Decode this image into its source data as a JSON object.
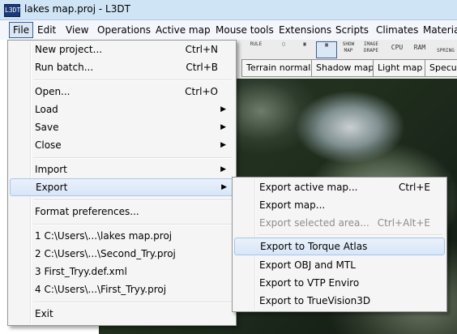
{
  "window": {
    "title": "lakes map.proj - L3DT",
    "icon": "L3DT"
  },
  "menubar": [
    "File",
    "Edit",
    "View",
    "Operations",
    "Active map",
    "Mouse tools",
    "Extensions",
    "Scripts",
    "Climates",
    "Materia"
  ],
  "toolbar": [
    "RULE",
    "SHOW MAP",
    "IMAGE DRAPE",
    "CPU",
    "RAM",
    "SPRING"
  ],
  "map_tabs": [
    "Terrain normals",
    "Shadow map",
    "Light map",
    "Specula"
  ],
  "file_menu": {
    "new_project": {
      "label": "New project...",
      "shortcut": "Ctrl+N"
    },
    "run_batch": {
      "label": "Run batch...",
      "shortcut": "Ctrl+B"
    },
    "open": {
      "label": "Open...",
      "shortcut": "Ctrl+O"
    },
    "load": "Load",
    "save": "Save",
    "close": "Close",
    "import": "Import",
    "export": "Export",
    "format_prefs": "Format preferences...",
    "recent": [
      "1 C:\\Users\\...\\lakes map.proj",
      "2 C:\\Users\\...\\Second_Try.proj",
      "3 First_Tryy.def.xml",
      "4 C:\\Users\\...\\First_Tryy.proj"
    ],
    "exit": "Exit"
  },
  "export_menu": {
    "active_map": {
      "label": "Export active map...",
      "shortcut": "Ctrl+E"
    },
    "map": {
      "label": "Export map..."
    },
    "selected_area": {
      "label": "Export selected area...",
      "shortcut": "Ctrl+Alt+E"
    },
    "torque_atlas": {
      "label": "Export to Torque Atlas"
    },
    "obj_mtl": {
      "label": "Export OBJ and MTL"
    },
    "vtp_enviro": {
      "label": "Export to VTP Enviro"
    },
    "truevision3d": {
      "label": "Export to TrueVision3D"
    }
  }
}
